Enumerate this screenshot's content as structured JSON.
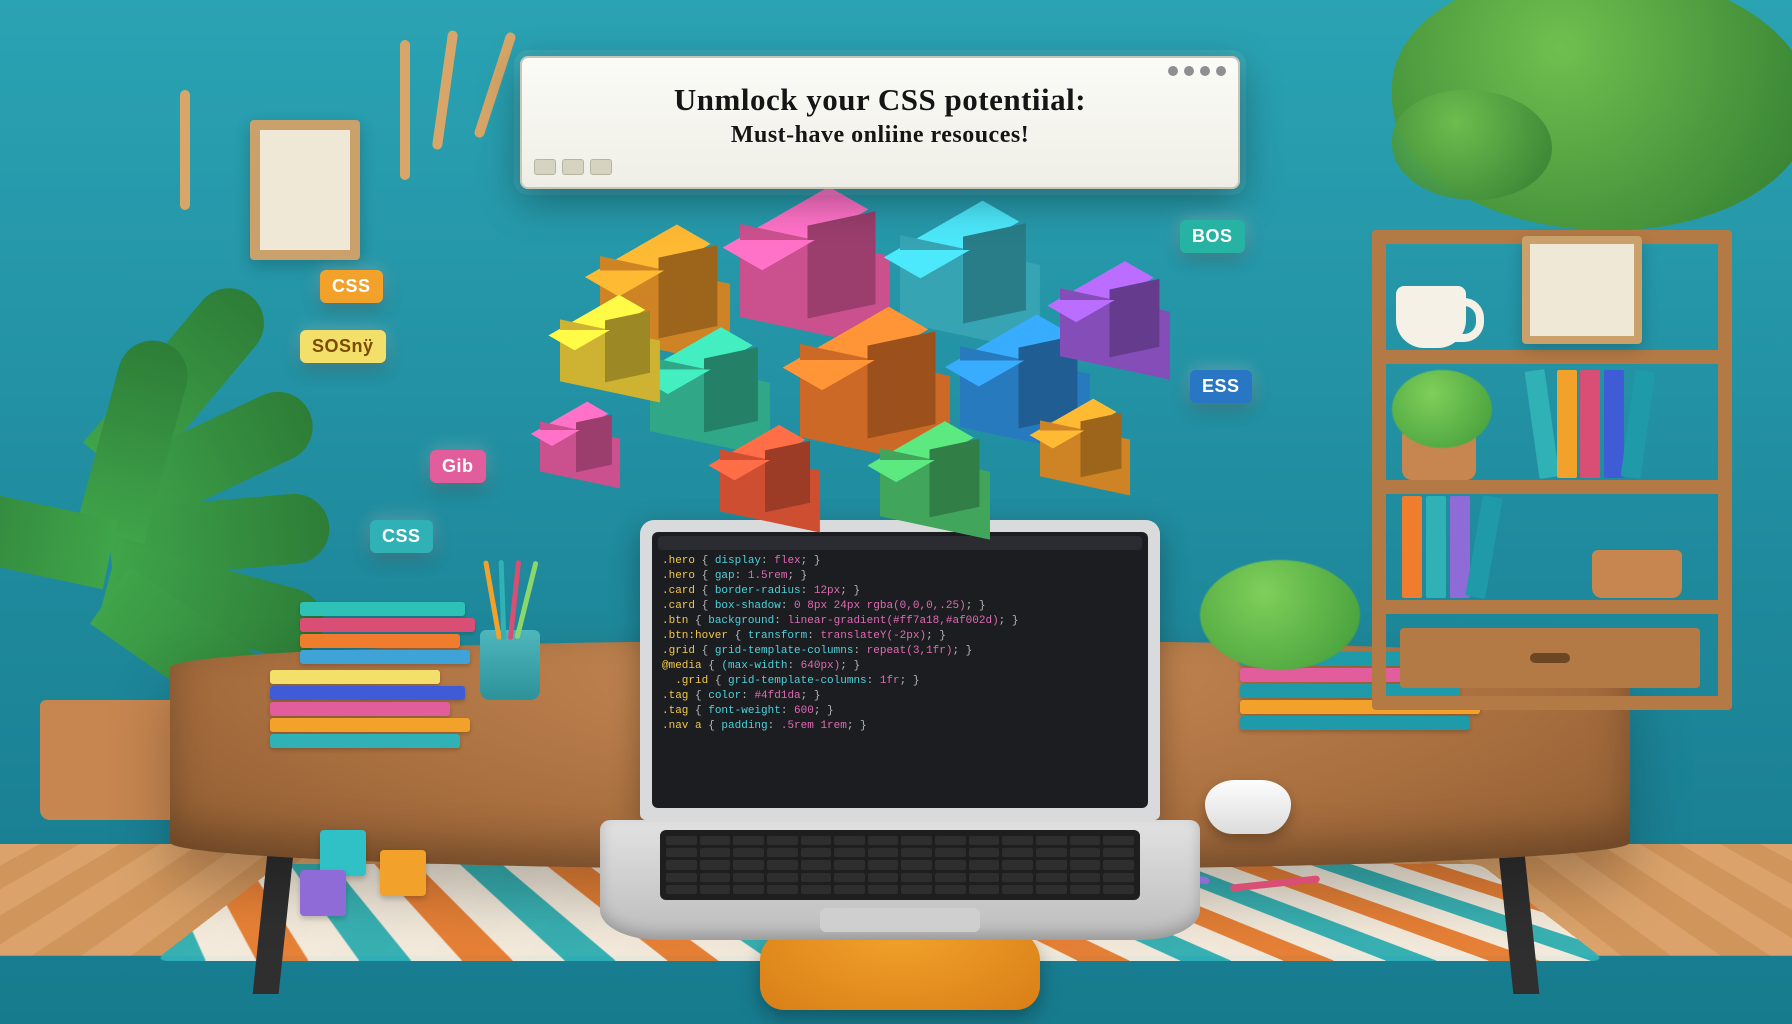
{
  "banner": {
    "title_line1": "Unmlock your CSS potentiial:",
    "title_line2": "Must-have onliine resouces!"
  },
  "chips": {
    "css_orange": "CSS",
    "css_teal": "CSS",
    "bos": "BOS",
    "ess": "ESS",
    "sosny": "SOSnÿ",
    "gib": "Gib"
  },
  "code_lines": [
    {
      "sel": ".hero",
      "prop": "display",
      "val": "flex"
    },
    {
      "sel": ".hero",
      "prop": "gap",
      "val": "1.5rem"
    },
    {
      "sel": ".card",
      "prop": "border-radius",
      "val": "12px"
    },
    {
      "sel": ".card",
      "prop": "box-shadow",
      "val": "0 8px 24px rgba(0,0,0,.25)"
    },
    {
      "sel": ".btn",
      "prop": "background",
      "val": "linear-gradient(#ff7a18,#af002d)"
    },
    {
      "sel": ".btn:hover",
      "prop": "transform",
      "val": "translateY(-2px)"
    },
    {
      "sel": ".grid",
      "prop": "grid-template-columns",
      "val": "repeat(3,1fr)"
    },
    {
      "sel": "@media",
      "prop": "(max-width",
      "val": "640px)"
    },
    {
      "sel": "  .grid",
      "prop": "grid-template-columns",
      "val": "1fr"
    },
    {
      "sel": ".tag",
      "prop": "color",
      "val": "#4fd1da"
    },
    {
      "sel": ".tag",
      "prop": "font-weight",
      "val": "600"
    },
    {
      "sel": ".nav a",
      "prop": "padding",
      "val": ".5rem 1rem"
    }
  ]
}
